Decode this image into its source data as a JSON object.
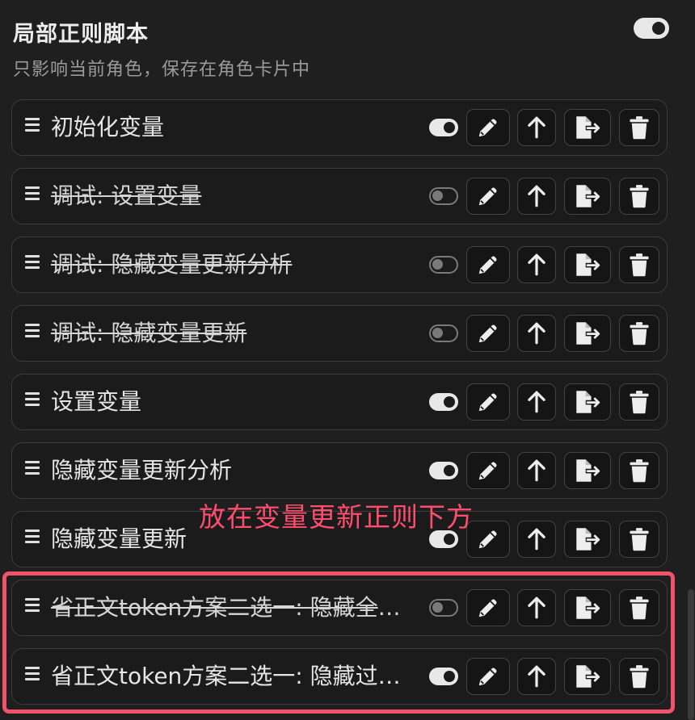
{
  "header": {
    "title": "局部正则脚本",
    "subtitle": "只影响当前角色，保存在角色卡片中",
    "enabled": true
  },
  "scripts": [
    {
      "name": "初始化变量",
      "enabled": true
    },
    {
      "name": "调试: 设置变量",
      "enabled": false
    },
    {
      "name": "调试: 隐藏变量更新分析",
      "enabled": false
    },
    {
      "name": "调试: 隐藏变量更新",
      "enabled": false
    },
    {
      "name": "设置变量",
      "enabled": true
    },
    {
      "name": "隐藏变量更新分析",
      "enabled": true
    },
    {
      "name": "隐藏变量更新",
      "enabled": true
    },
    {
      "name": "省正文token方案二选一: 隐藏全部变量更新",
      "enabled": false
    },
    {
      "name": "省正文token方案二选一: 隐藏过去变量更新",
      "enabled": true
    }
  ],
  "icons": {
    "drag": "drag-handle-icon",
    "edit": "pencil-icon",
    "move_up": "arrow-up-icon",
    "export": "file-export-icon",
    "delete": "trash-icon"
  },
  "annotation": {
    "text": "放在变量更新正则下方",
    "color": "#ff4d6d"
  },
  "highlight_color": "#f0536b"
}
